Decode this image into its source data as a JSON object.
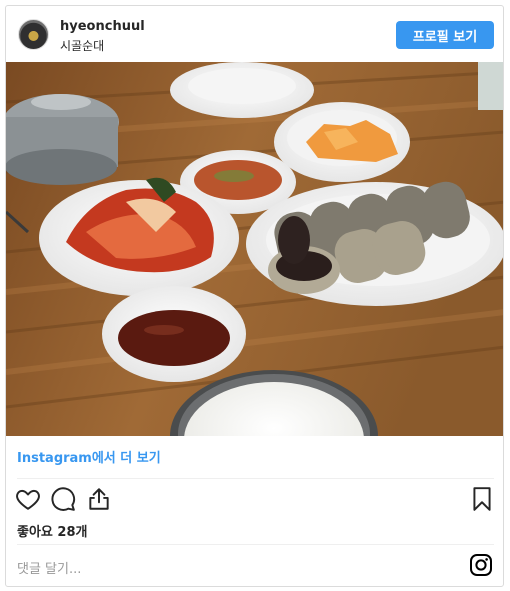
{
  "header": {
    "username": "hyeonchuul",
    "location": "시골순대",
    "profile_button": "프로필 보기"
  },
  "post": {
    "view_more_link": "Instagram에서 더 보기",
    "likes_text": "좋아요 28개",
    "comment_placeholder": "댓글 달기..."
  },
  "icons": {
    "like": "heart-icon",
    "comment": "comment-bubble-icon",
    "share": "share-icon",
    "save": "bookmark-icon",
    "logo": "instagram-logo-icon"
  },
  "colors": {
    "accent": "#3897f0",
    "border": "#dbdbdb",
    "text": "#262626",
    "muted": "#999999"
  }
}
